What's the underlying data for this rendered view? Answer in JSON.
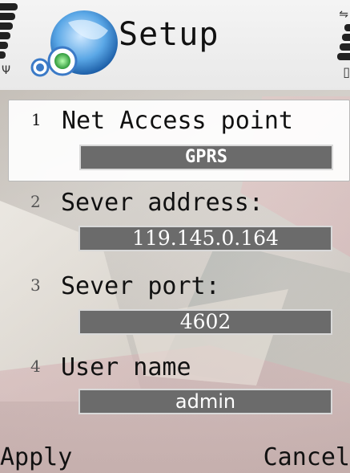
{
  "header": {
    "title": "Setup",
    "app_icon": "network-globe-icon"
  },
  "status": {
    "signal_icon": "antenna-icon",
    "battery_icon": "battery-icon",
    "network_icon": "network-transfer-icon"
  },
  "setup_items": [
    {
      "number": "1",
      "label": "Net Access point",
      "value": "GPRS",
      "selected": true
    },
    {
      "number": "2",
      "label": "Sever address:",
      "value": "119.145.0.164",
      "selected": false
    },
    {
      "number": "3",
      "label": "Sever port:",
      "value": "4602",
      "selected": false
    },
    {
      "number": "4",
      "label": "User name",
      "value": "admin",
      "selected": false
    }
  ],
  "softkeys": {
    "left": "Apply",
    "right": "Cancel"
  },
  "colors": {
    "value_box": "#6b6b6b",
    "header_bg": "#f4f4f4"
  }
}
